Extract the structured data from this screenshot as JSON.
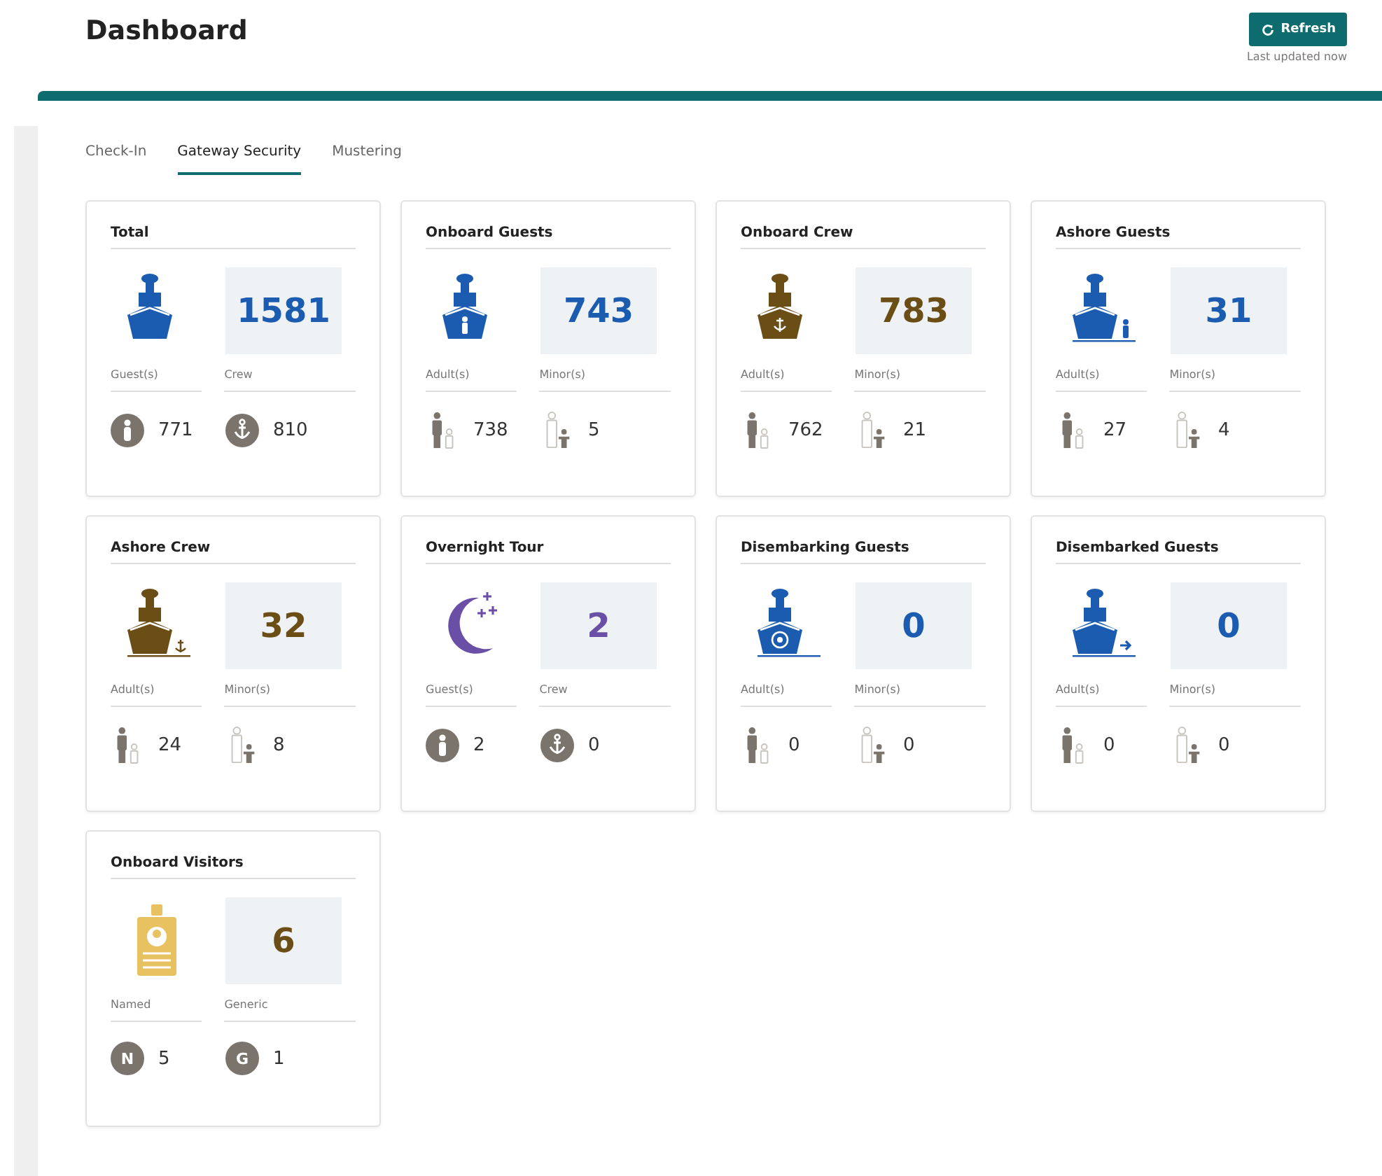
{
  "header": {
    "title": "Dashboard",
    "refresh_button": "Refresh",
    "last_updated": "Last updated now"
  },
  "tabs": [
    {
      "label": "Check-In",
      "selected": false
    },
    {
      "label": "Gateway Security",
      "selected": true
    },
    {
      "label": "Mustering",
      "selected": false
    }
  ],
  "cards": [
    {
      "title": "Total",
      "kind": "ship",
      "color": "#1b5cb0",
      "count": "1581",
      "labels": [
        "Guest(s)",
        "Crew"
      ],
      "stats": [
        {
          "kind": "person-circle",
          "value": "771"
        },
        {
          "kind": "anchor-circle",
          "value": "810"
        }
      ]
    },
    {
      "title": "Onboard Guests",
      "kind": "ship-person",
      "color": "#1b5cb0",
      "count": "743",
      "labels": [
        "Adult(s)",
        "Minor(s)"
      ],
      "stats": [
        {
          "kind": "adult",
          "value": "738"
        },
        {
          "kind": "minor",
          "value": "5"
        }
      ]
    },
    {
      "title": "Onboard Crew",
      "kind": "ship-anchor",
      "color": "#6b4e16",
      "count": "783",
      "labels": [
        "Adult(s)",
        "Minor(s)"
      ],
      "stats": [
        {
          "kind": "adult",
          "value": "762"
        },
        {
          "kind": "minor",
          "value": "21"
        }
      ]
    },
    {
      "title": "Ashore Guests",
      "kind": "ship-person-side",
      "color": "#1b5cb0",
      "count": "31",
      "labels": [
        "Adult(s)",
        "Minor(s)"
      ],
      "stats": [
        {
          "kind": "adult",
          "value": "27"
        },
        {
          "kind": "minor",
          "value": "4"
        }
      ]
    },
    {
      "title": "Ashore Crew",
      "kind": "ship-anchor-side",
      "color": "#6b4e16",
      "count": "32",
      "labels": [
        "Adult(s)",
        "Minor(s)"
      ],
      "stats": [
        {
          "kind": "adult",
          "value": "24"
        },
        {
          "kind": "minor",
          "value": "8"
        }
      ]
    },
    {
      "title": "Overnight Tour",
      "kind": "moon",
      "color": "#6a4fa6",
      "count": "2",
      "labels": [
        "Guest(s)",
        "Crew"
      ],
      "stats": [
        {
          "kind": "person-circle",
          "value": "2"
        },
        {
          "kind": "anchor-circle",
          "value": "0"
        }
      ]
    },
    {
      "title": "Disembarking Guests",
      "kind": "ship-wheel",
      "color": "#1b5cb0",
      "count": "0",
      "labels": [
        "Adult(s)",
        "Minor(s)"
      ],
      "stats": [
        {
          "kind": "adult",
          "value": "0"
        },
        {
          "kind": "minor",
          "value": "0"
        }
      ]
    },
    {
      "title": "Disembarked Guests",
      "kind": "ship-arrow",
      "color": "#1b5cb0",
      "count": "0",
      "labels": [
        "Adult(s)",
        "Minor(s)"
      ],
      "stats": [
        {
          "kind": "adult",
          "value": "0"
        },
        {
          "kind": "minor",
          "value": "0"
        }
      ]
    },
    {
      "title": "Onboard Visitors",
      "kind": "id-badge",
      "color": "#6b4e16",
      "count": "6",
      "labels": [
        "Named",
        "Generic"
      ],
      "stats": [
        {
          "kind": "letter",
          "letter": "N",
          "value": "5"
        },
        {
          "kind": "letter",
          "letter": "G",
          "value": "1"
        }
      ]
    }
  ]
}
